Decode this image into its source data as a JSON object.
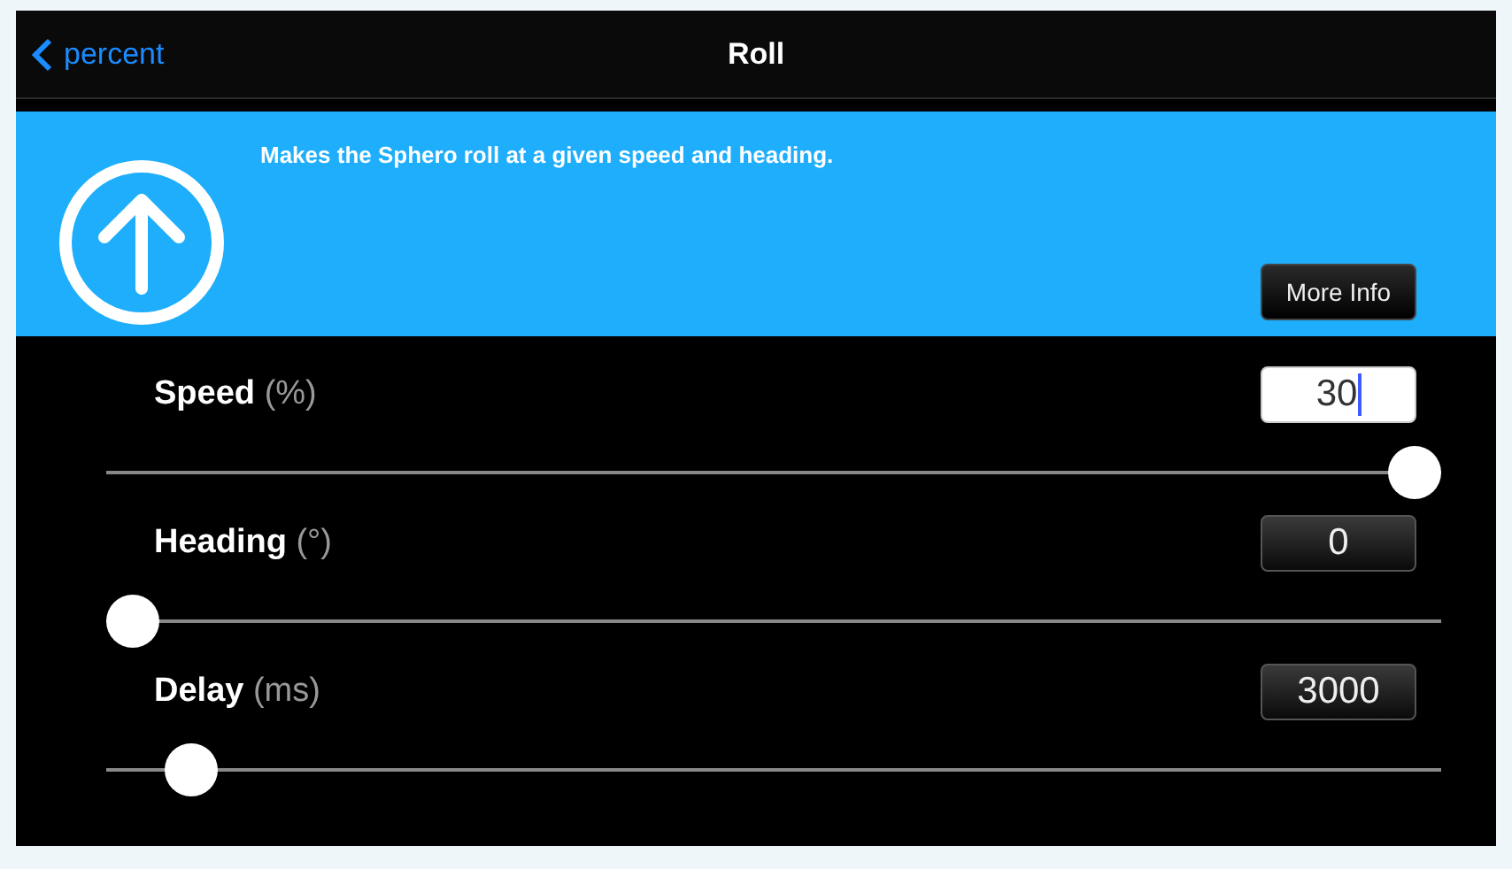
{
  "nav": {
    "back": "percent",
    "title": "Roll"
  },
  "banner": {
    "description": "Makes the Sphero roll at a given speed and heading.",
    "button": "More Info"
  },
  "params": [
    {
      "label": "Speed",
      "unit": "(%)",
      "value": "30",
      "editing": true,
      "level": 1.0
    },
    {
      "label": "Heading",
      "unit": "(°)",
      "value": "0",
      "editing": false,
      "level": 0
    },
    {
      "label": "Delay",
      "unit": "(ms)",
      "value": "3000",
      "editing": false,
      "level": 0.045
    }
  ]
}
